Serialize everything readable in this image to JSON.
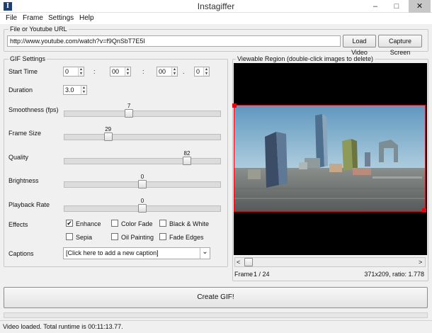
{
  "window": {
    "title": "Instagiffer",
    "app_icon_glyph": "I",
    "minimize_glyph": "–",
    "maximize_glyph": "□",
    "close_glyph": "✕"
  },
  "menu": [
    "File",
    "Frame",
    "Settings",
    "Help"
  ],
  "url_group": {
    "legend": "File or Youtube URL",
    "url_value": "http://www.youtube.com/watch?v=f9QnSbT7E5I",
    "load_button": "Load Video",
    "capture_button": "Capture Screen"
  },
  "gif_settings": {
    "legend": "GIF Settings",
    "start_time_label": "Start Time",
    "start_time": [
      "0",
      "00",
      "00",
      "0"
    ],
    "separators": [
      ":",
      ":",
      "."
    ],
    "duration_label": "Duration",
    "duration": "3.0",
    "spin_up": "▲",
    "spin_down": "▼",
    "sliders": [
      {
        "label": "Smoothness (fps)",
        "value": "7",
        "fraction": 0.41
      },
      {
        "label": "Frame Size",
        "value": "29",
        "fraction": 0.27
      },
      {
        "label": "Quality",
        "value": "82",
        "fraction": 0.8
      },
      {
        "label": "Brightness",
        "value": "0",
        "fraction": 0.5
      },
      {
        "label": "Playback Rate",
        "value": "0",
        "fraction": 0.5
      }
    ],
    "effects_label": "Effects",
    "effects": [
      {
        "label": "Enhance",
        "checked": true
      },
      {
        "label": "Color Fade",
        "checked": false
      },
      {
        "label": "Black & White",
        "checked": false
      },
      {
        "label": "Sepia",
        "checked": false
      },
      {
        "label": "Oil Painting",
        "checked": false
      },
      {
        "label": "Fade Edges",
        "checked": false
      }
    ],
    "check_glyph": "✔",
    "captions_label": "Captions",
    "captions_value": "[Click here to add a new caption]",
    "dropdown_glyph": "⌄"
  },
  "viewable_region": {
    "legend": "Viewable Region (double-click images to delete)",
    "frame_label": "Frame",
    "frame_value": "1 / 24",
    "info": "371x209, ratio: 1.778",
    "scroll_left": "<",
    "scroll_right": ">"
  },
  "create_button": "Create GIF!",
  "status": "Video loaded. Total runtime is 00:11:13.77.",
  "colors": {
    "selection_handle": "#e8000c",
    "sky_top": "#6fa3c7",
    "sky_bottom": "#cfe1ea"
  }
}
